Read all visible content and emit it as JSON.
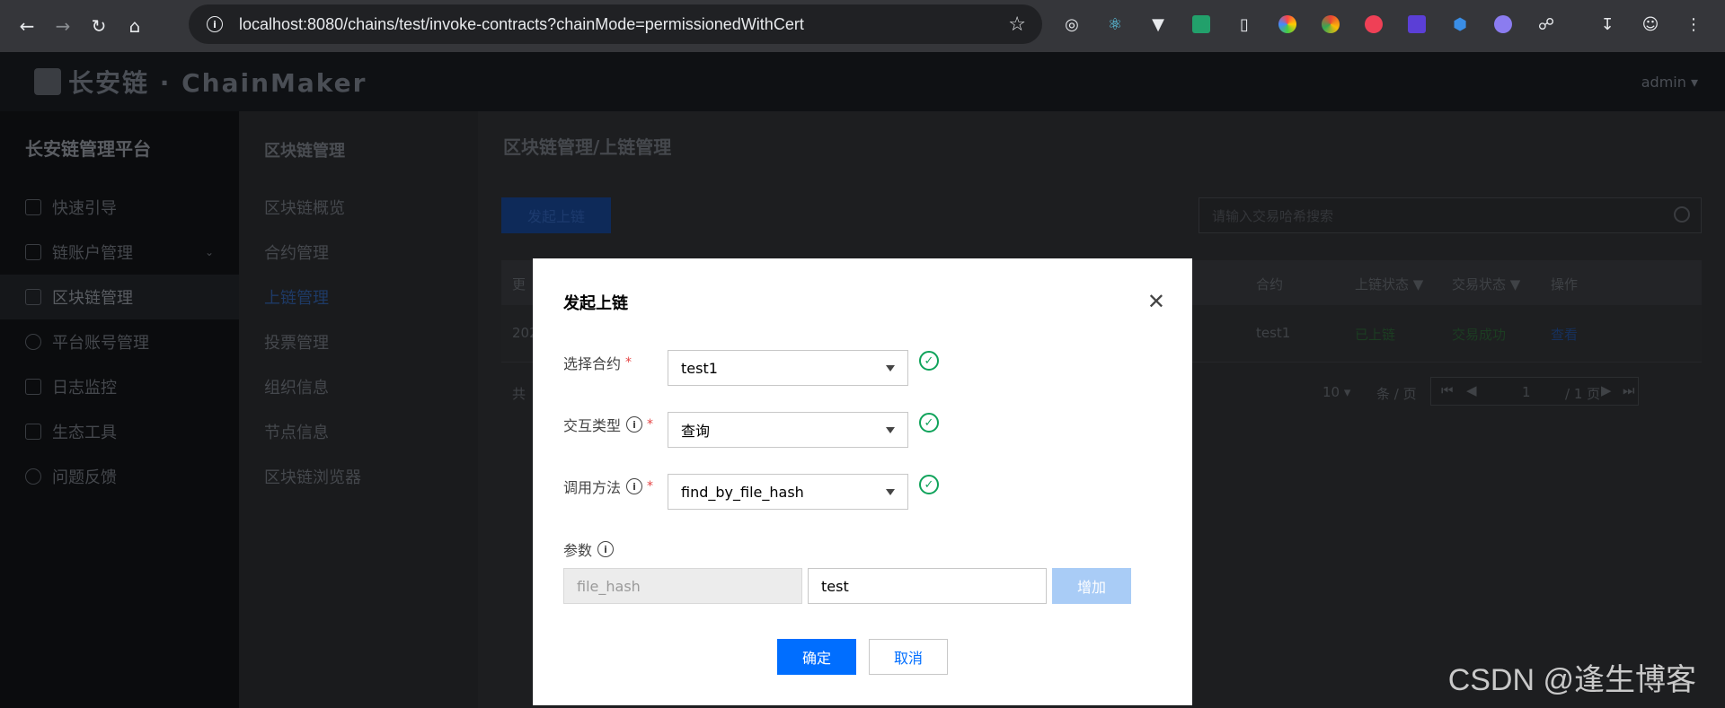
{
  "browser": {
    "url": "localhost:8080/chains/test/invoke-contracts?chainMode=permissionedWithCert"
  },
  "header": {
    "logo_text": "长安链 · ChainMaker",
    "user": "admin"
  },
  "sidebar": {
    "title": "长安链管理平台",
    "items": [
      {
        "label": "快速引导"
      },
      {
        "label": "链账户管理"
      },
      {
        "label": "区块链管理"
      },
      {
        "label": "平台账号管理"
      },
      {
        "label": "日志监控"
      },
      {
        "label": "生态工具"
      },
      {
        "label": "问题反馈"
      }
    ]
  },
  "subbar": {
    "title": "区块链管理",
    "items": [
      {
        "label": "区块链概览"
      },
      {
        "label": "合约管理"
      },
      {
        "label": "上链管理"
      },
      {
        "label": "投票管理"
      },
      {
        "label": "组织信息"
      },
      {
        "label": "节点信息"
      },
      {
        "label": "区块链浏览器"
      }
    ]
  },
  "main": {
    "breadcrumb": "区块链管理/上链管理",
    "launch_button": "发起上链",
    "search_placeholder": "请输入交易哈希搜索",
    "columns": {
      "first": "更",
      "contract": "合约",
      "chain_status": "上链状态",
      "tx_status": "交易状态",
      "actions": "操作"
    },
    "row": {
      "first": "202",
      "contract": "test1",
      "chain_status": "已上链",
      "tx_status": "交易成功",
      "action": "查看"
    },
    "pager": {
      "total_prefix": "共",
      "page_size": "10",
      "per_page": "条 / 页",
      "current": "1",
      "of_pages": "/ 1 页"
    }
  },
  "dialog": {
    "title": "发起上链",
    "contract_label": "选择合约",
    "contract_value": "test1",
    "type_label": "交互类型",
    "type_value": "查询",
    "method_label": "调用方法",
    "method_value": "find_by_file_hash",
    "params_label": "参数",
    "param_name": "file_hash",
    "param_value": "test",
    "add_button": "增加",
    "confirm_button": "确定",
    "cancel_button": "取消"
  },
  "watermark": "CSDN @逢生博客"
}
